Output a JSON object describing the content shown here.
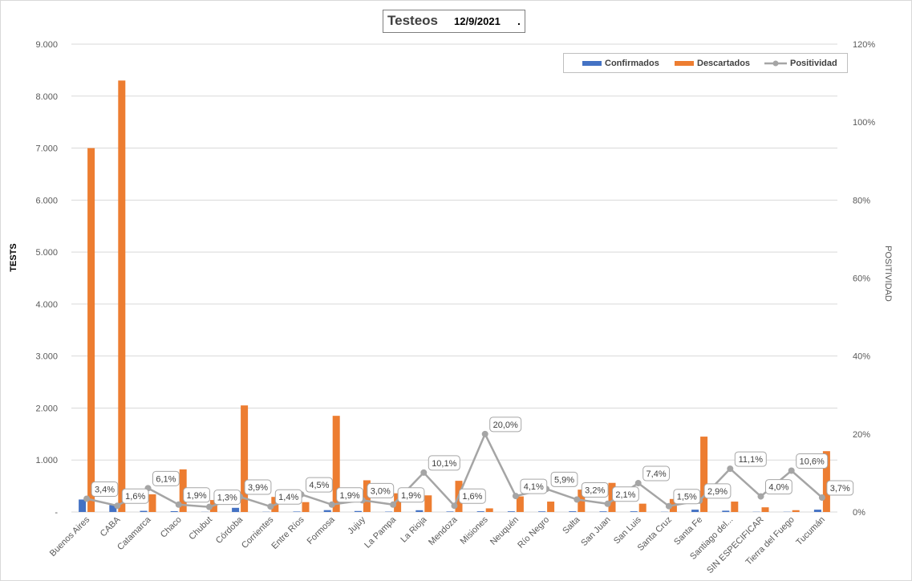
{
  "chart_data": {
    "type": "bar",
    "title": "Testeos",
    "date": "12/9/2021",
    "title_mark": ".",
    "ylabel": "TESTS",
    "y2label": "POSITIVIDAD",
    "ylim": [
      0,
      9000
    ],
    "y_ticks": [
      "-",
      "1.000",
      "2.000",
      "3.000",
      "4.000",
      "5.000",
      "6.000",
      "7.000",
      "8.000",
      "9.000"
    ],
    "y2lim": [
      0,
      120
    ],
    "y2_ticks": [
      "0%",
      "20%",
      "40%",
      "60%",
      "80%",
      "100%",
      "120%"
    ],
    "grid": true,
    "legend_position": "top-right",
    "categories": [
      "Buenos Aires",
      "CABA",
      "Catamarca",
      "Chaco",
      "Chubut",
      "Córdoba",
      "Corrientes",
      "Entre Ríos",
      "Formosa",
      "Jujuy",
      "La Pampa",
      "La Rioja",
      "Mendoza",
      "Misiones",
      "Neuquén",
      "Río Negro",
      "Salta",
      "San Juan",
      "San Luis",
      "Santa Cruz",
      "Santa Fe",
      "Santiago del...",
      "SIN ESPECIFICAR",
      "Tierra del Fuego",
      "Tucumán"
    ],
    "series": [
      {
        "name": "Confirmados",
        "type": "bar",
        "color": "#4472c4",
        "values": [
          240,
          135,
          22,
          16,
          3,
          80,
          4,
          9,
          36,
          19,
          7,
          34,
          10,
          14,
          13,
          12,
          14,
          12,
          13,
          4,
          45,
          25,
          4,
          4,
          45
        ]
      },
      {
        "name": "Descartados",
        "type": "bar",
        "color": "#ed7d31",
        "values": [
          7000,
          8300,
          340,
          820,
          230,
          2050,
          290,
          190,
          1850,
          610,
          360,
          320,
          600,
          70,
          300,
          200,
          430,
          560,
          160,
          250,
          1450,
          200,
          90,
          35,
          1170
        ]
      },
      {
        "name": "Positividad",
        "type": "line",
        "axis": "secondary",
        "color": "#a5a5a5",
        "values": [
          3.4,
          1.6,
          6.1,
          1.9,
          1.3,
          3.9,
          1.4,
          4.5,
          1.9,
          3.0,
          1.9,
          10.1,
          1.6,
          20.0,
          4.1,
          5.9,
          3.2,
          2.1,
          7.4,
          1.5,
          2.9,
          11.1,
          4.0,
          10.6,
          3.7
        ],
        "labels": [
          "3,4%",
          "1,6%",
          "6,1%",
          "1,9%",
          "1,3%",
          "3,9%",
          "1,4%",
          "4,5%",
          "1,9%",
          "3,0%",
          "1,9%",
          "10,1%",
          "1,6%",
          "20,0%",
          "4,1%",
          "5,9%",
          "3,2%",
          "2,1%",
          "7,4%",
          "1,5%",
          "2,9%",
          "11,1%",
          "4,0%",
          "10,6%",
          "3,7%"
        ]
      }
    ]
  }
}
